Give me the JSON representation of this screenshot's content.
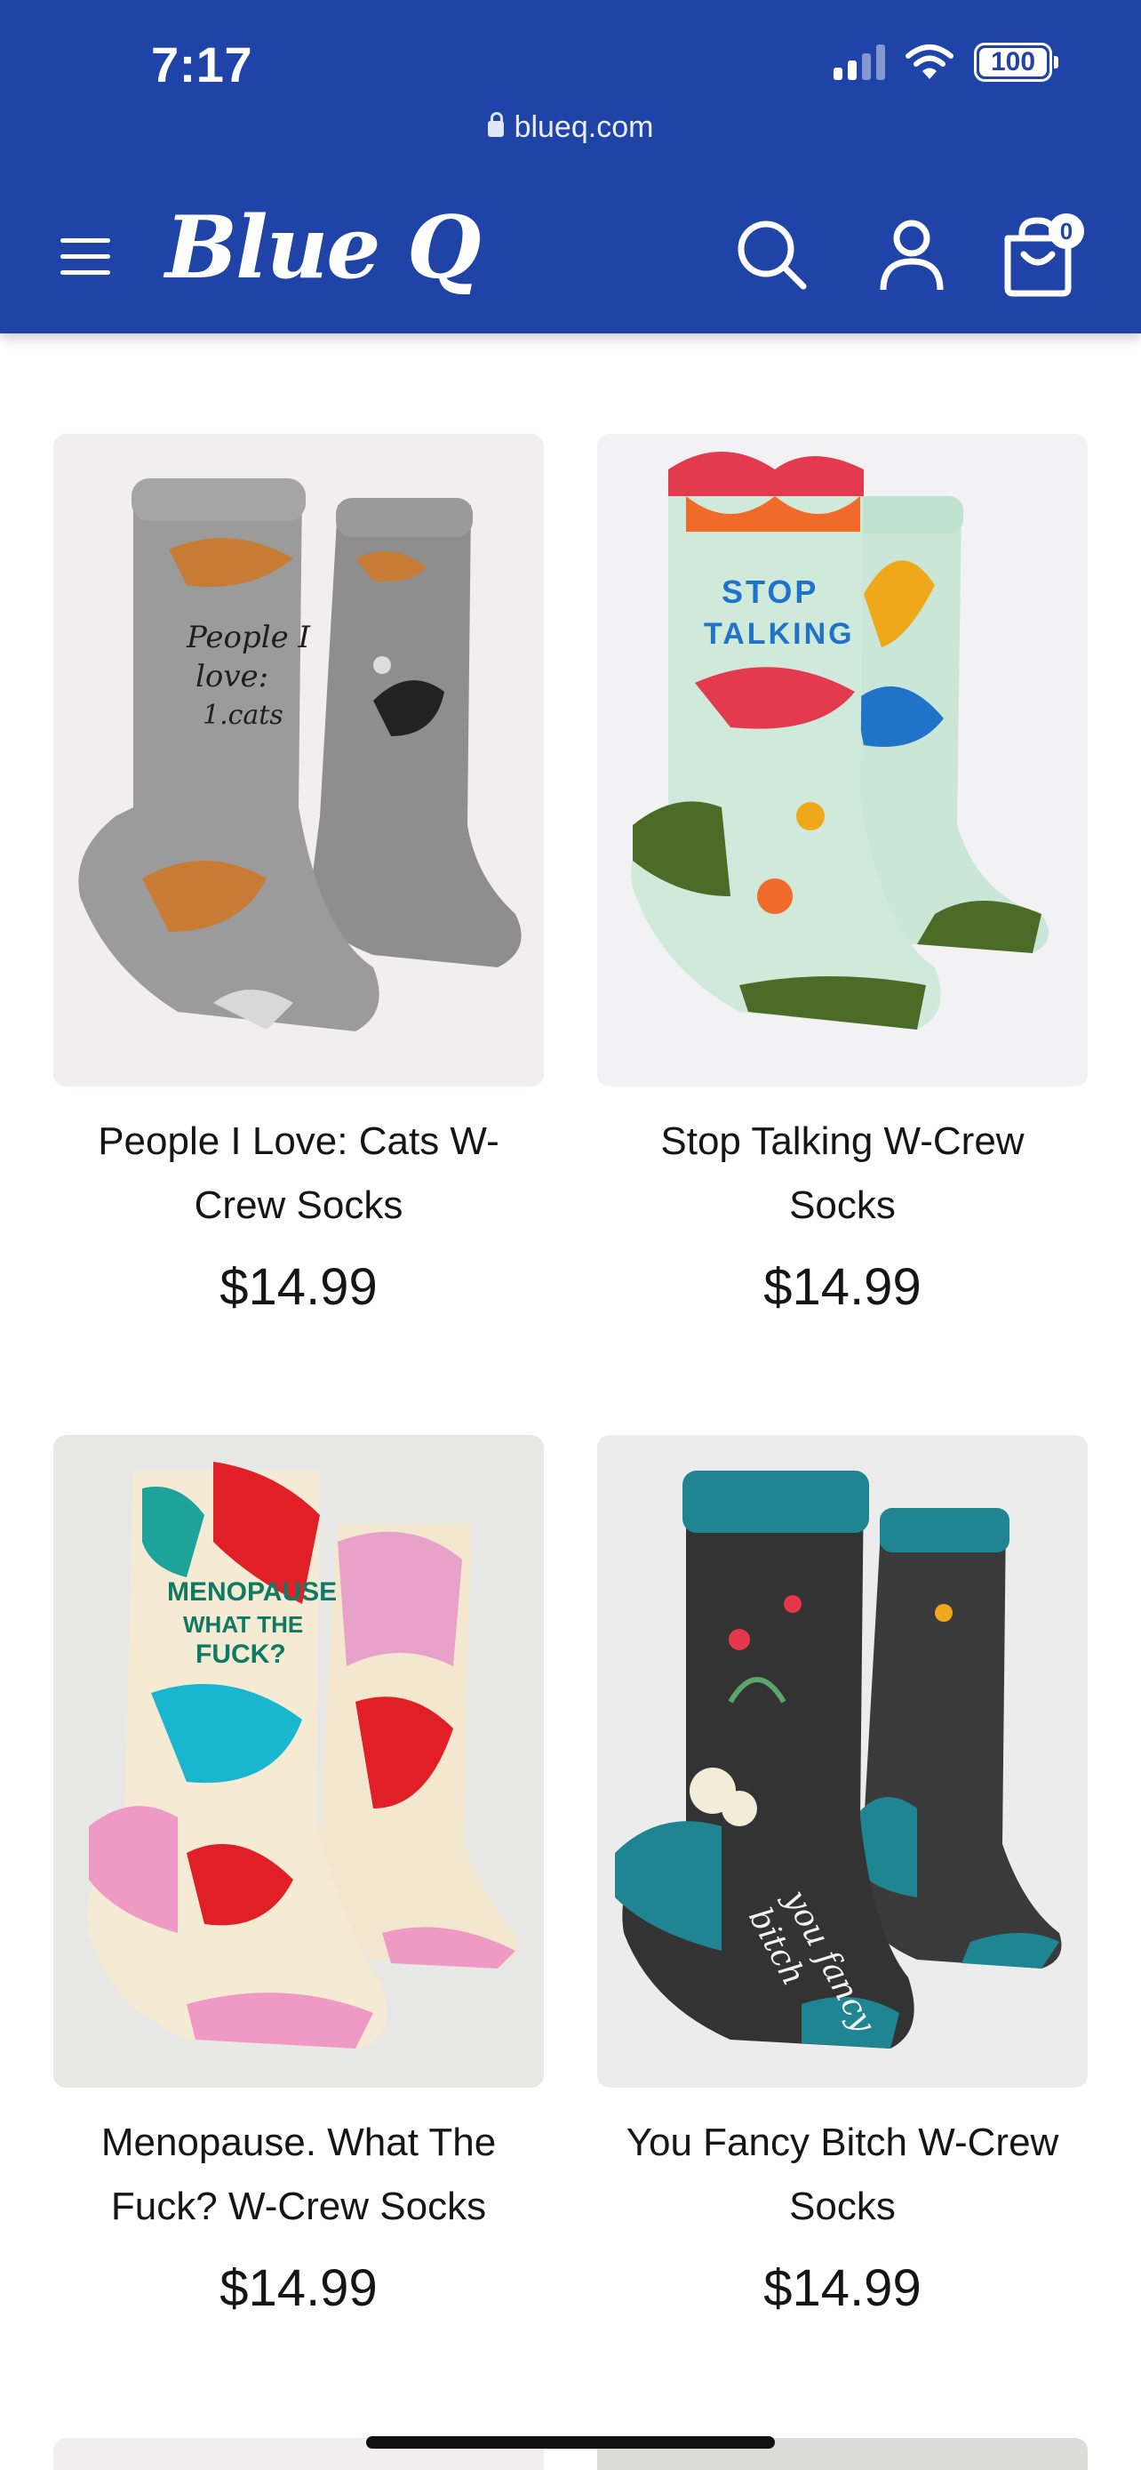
{
  "status_bar": {
    "time": "7:17",
    "battery": "100"
  },
  "browser": {
    "url": "blueq.com"
  },
  "header": {
    "logo_text": "Blue Q",
    "cart_count": "0"
  },
  "icons": [
    "menu-icon",
    "search-icon",
    "account-icon",
    "cart-icon",
    "lock-icon"
  ],
  "colors": {
    "header_bg": "#1f43a6",
    "text": "#151515"
  },
  "products": [
    {
      "title": "People I Love: Cats W-Crew Socks",
      "price": "$14.99",
      "sock_text": "People I love: 1.cats"
    },
    {
      "title": "Stop Talking W-Crew Socks",
      "price": "$14.99",
      "sock_text": "STOP TALKING"
    },
    {
      "title": "Menopause. What The Fuck? W-Crew Socks",
      "price": "$14.99",
      "sock_text": "MENOPAUSE WHAT THE FUCK?"
    },
    {
      "title": "You Fancy Bitch W-Crew Socks",
      "price": "$14.99",
      "sock_text": "you fancy bitch"
    }
  ]
}
